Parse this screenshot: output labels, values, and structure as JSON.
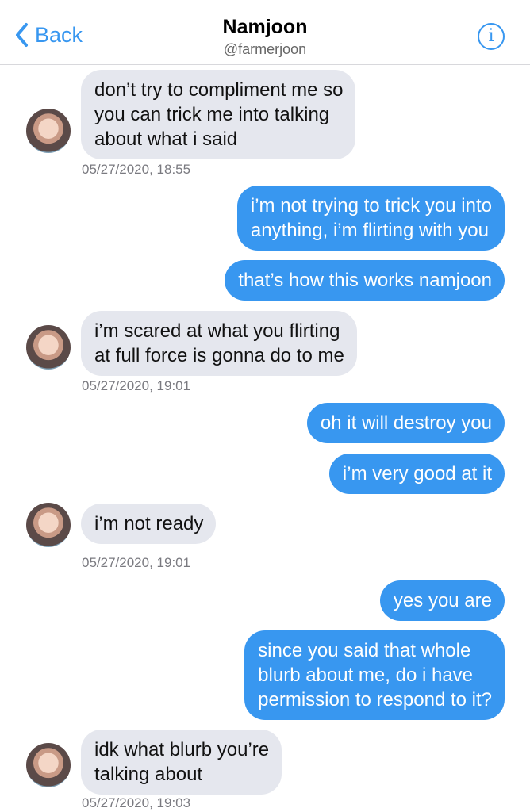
{
  "header": {
    "back_label": "Back",
    "title": "Namjoon",
    "handle": "@farmerjoon",
    "info_icon": "info-icon"
  },
  "colors": {
    "accent": "#3897f0",
    "received_bubble": "#e5e7ee"
  },
  "messages": [
    {
      "from": "them",
      "lines": [
        "don’t try to compliment me so",
        "you can trick me into talking",
        "about what i said"
      ],
      "timestamp": "05/27/2020, 18:55"
    },
    {
      "from": "me",
      "lines": [
        "i’m not trying to trick you into",
        "anything, i’m flirting with you"
      ]
    },
    {
      "from": "me",
      "lines": [
        "that’s how this works namjoon"
      ]
    },
    {
      "from": "them",
      "lines": [
        "i’m scared at what you flirting",
        "at full force is gonna do to me"
      ],
      "timestamp": "05/27/2020, 19:01"
    },
    {
      "from": "me",
      "lines": [
        "oh it will destroy you"
      ]
    },
    {
      "from": "me",
      "lines": [
        "i’m very good at it"
      ]
    },
    {
      "from": "them",
      "lines": [
        "i’m not ready"
      ],
      "timestamp": "05/27/2020, 19:01"
    },
    {
      "from": "me",
      "lines": [
        "yes you are"
      ]
    },
    {
      "from": "me",
      "lines": [
        "since you said that whole",
        "blurb about me, do i have",
        "permission to respond to it?"
      ]
    },
    {
      "from": "them",
      "lines": [
        "idk what blurb you’re",
        "talking about"
      ],
      "timestamp": "05/27/2020, 19:03"
    }
  ]
}
